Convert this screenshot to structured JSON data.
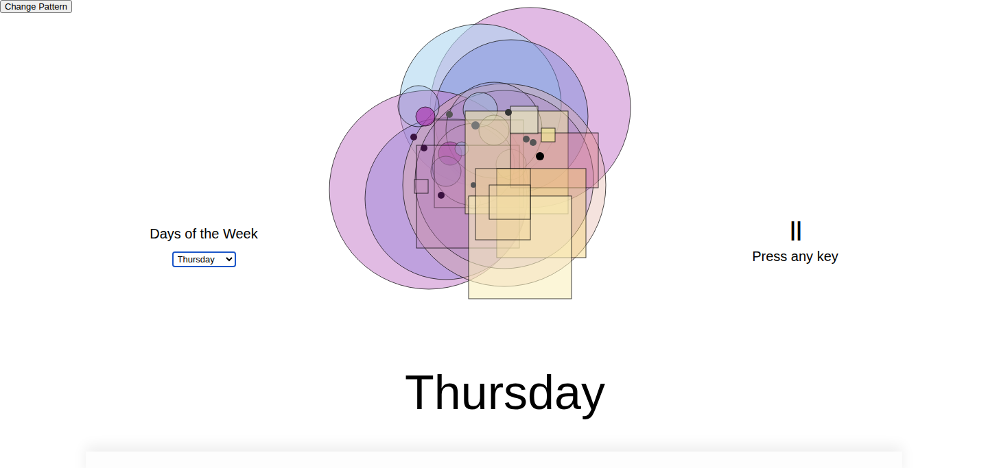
{
  "controls": {
    "change_pattern_button": "Change Pattern"
  },
  "day_picker": {
    "label": "Days of the Week",
    "selected_value": "Thursday"
  },
  "pause_indicator": {
    "glyph": "II",
    "hint": "Press any key"
  },
  "day_heading": "Thursday"
}
